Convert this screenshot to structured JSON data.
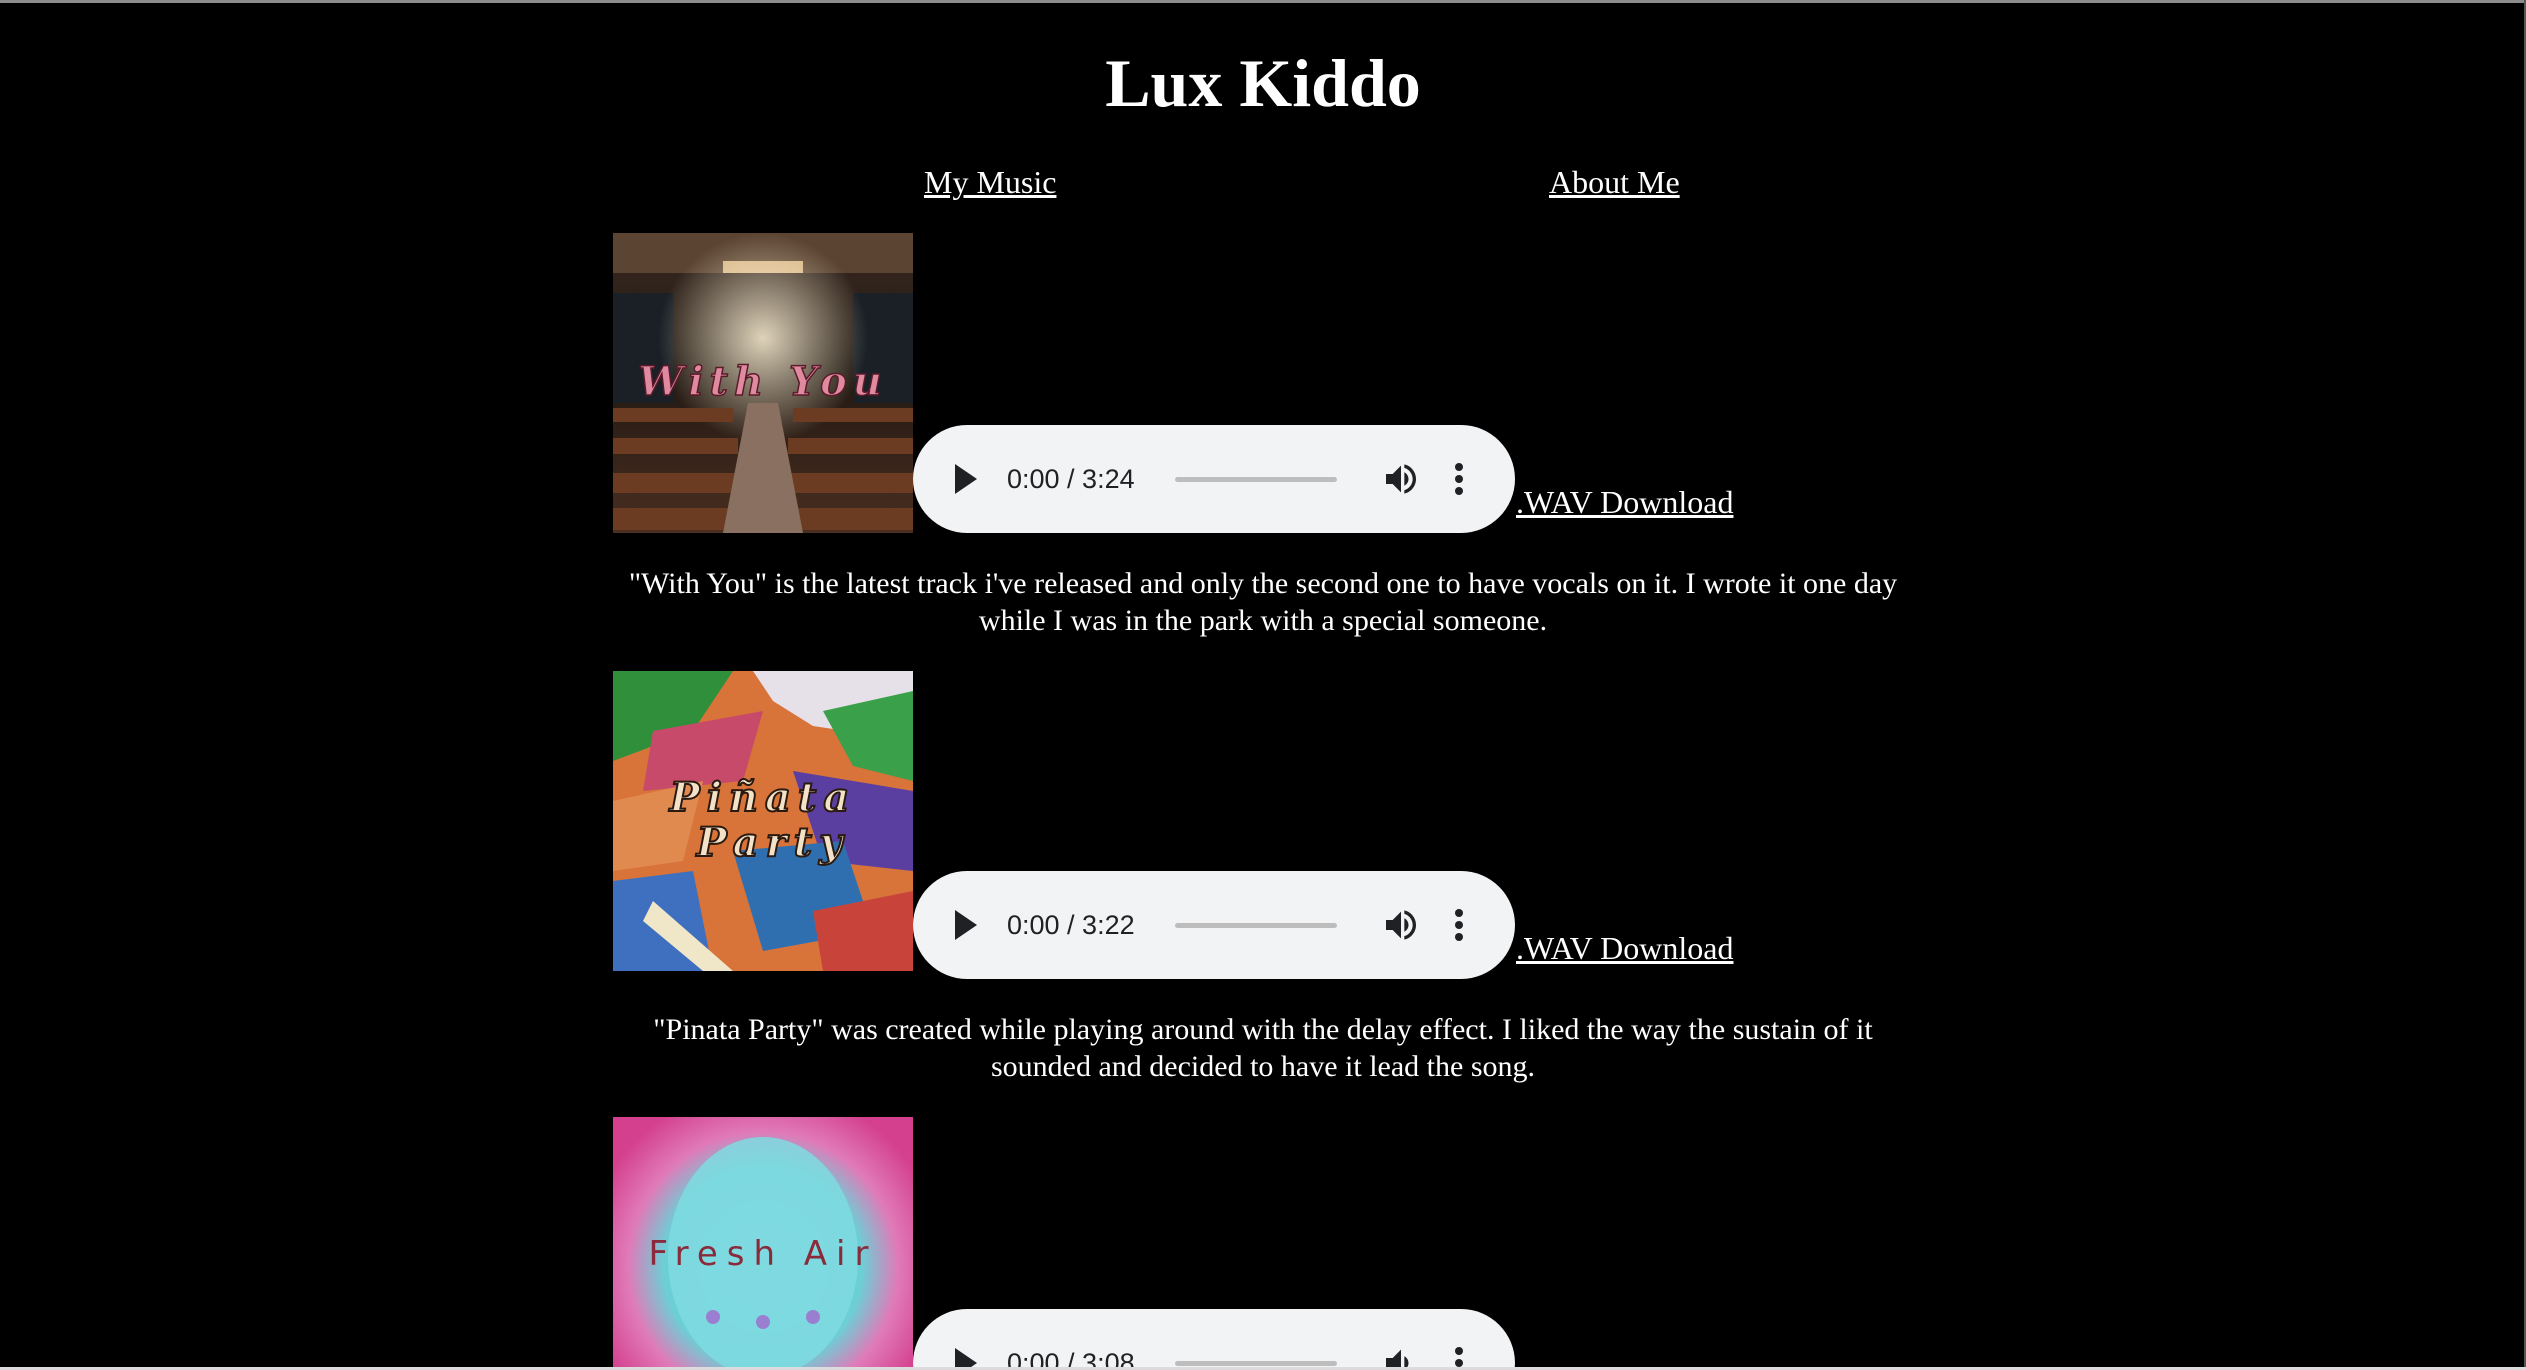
{
  "site": {
    "title": "Lux Kiddo"
  },
  "nav": {
    "items": [
      {
        "label": "My Music"
      },
      {
        "label": "About Me"
      }
    ]
  },
  "tracks": [
    {
      "cover_text": "With You",
      "time": "0:00 / 3:24",
      "progress": 0,
      "download_label": ".WAV Download",
      "description": "\"With You\" is the latest track i've released and only the second one to have vocals on it. I wrote it one day while I was in the park with a special someone."
    },
    {
      "cover_text_line1": "Piñata",
      "cover_text_line2": "Party",
      "time": "0:00 / 3:22",
      "progress": 0,
      "download_label": ".WAV Download",
      "description": "\"Pinata Party\" was created while playing around with the delay effect. I liked the way the sustain of it sounded and decided to have it lead the song."
    },
    {
      "cover_text": "Fresh Air",
      "time": "0:00 / 3:08",
      "progress": 0
    }
  ],
  "colors": {
    "background": "#000000",
    "text": "#ffffff",
    "player_bg": "#f1f3f4",
    "player_fg": "#202124"
  }
}
